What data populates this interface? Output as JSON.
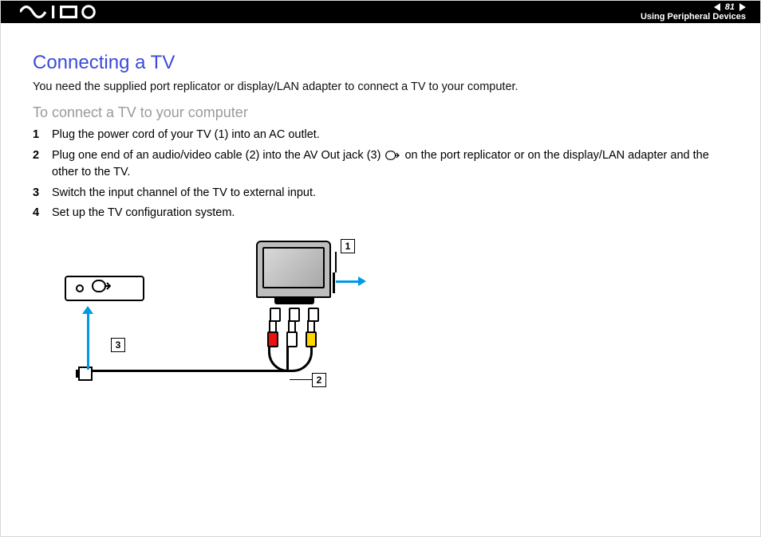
{
  "header": {
    "page_number": "81",
    "section": "Using Peripheral Devices"
  },
  "main": {
    "title": "Connecting a TV",
    "intro": "You need the supplied port replicator or display/LAN adapter to connect a TV to your computer.",
    "subtitle": "To connect a TV to your computer",
    "steps": [
      "Plug the power cord of your TV (1) into an AC outlet.",
      "Plug one end of an audio/video cable (2) into the AV Out jack (3) ⟶ on the port replicator or on the display/LAN adapter and the other to the TV.",
      "Switch the input channel of the TV to external input.",
      "Set up the TV configuration system."
    ]
  },
  "diagram": {
    "callouts": {
      "c1": "1",
      "c2": "2",
      "c3": "3"
    }
  }
}
